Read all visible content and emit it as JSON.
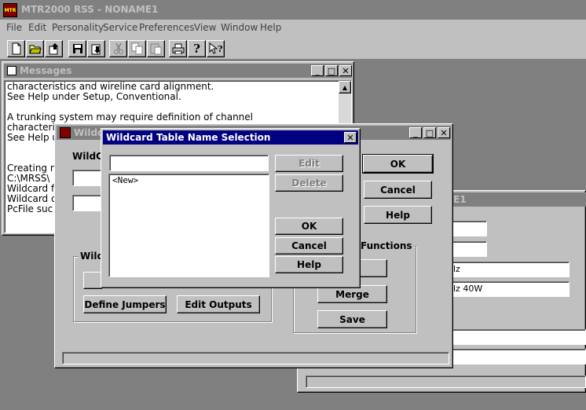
{
  "app": {
    "title": "MTR2000 RSS - NONAME1",
    "logo_text": "MTR"
  },
  "menu": [
    "File",
    "Edit",
    "Personality",
    "Service",
    "Preferences",
    "View",
    "Window",
    "Help"
  ],
  "toolbar_icons": [
    "new-file-icon",
    "open-folder-icon",
    "upload-icon",
    "save-disk-icon",
    "download-icon",
    "cut-icon",
    "copy-icon",
    "paste-icon",
    "print-icon",
    "help-question-icon",
    "context-help-icon"
  ],
  "messages": {
    "title": "Messages",
    "lines": [
      "characteristics and wireline card alignment.",
      "See Help under Setup, Conventional.",
      "",
      "A trunking system may require definition of channel",
      "characteristics",
      "See Help u",
      "",
      "",
      "Creating n",
      "C:\\MRSS\\",
      "Wildcard fi",
      "Wildcard d",
      "PcFile suc"
    ]
  },
  "wildcard_window": {
    "title": "Wildc",
    "label": "WildC",
    "ok": "OK",
    "cancel": "Cancel",
    "help": "Help",
    "group_label": "Wild",
    "define_jumpers": "Define Jumpers",
    "edit_outputs": "Edit Outputs",
    "functions_label": "Functions",
    "merge": "Merge",
    "save": "Save"
  },
  "background_window": {
    "title_fragment": "E1",
    "field_a": "lz",
    "field_b": "lz  40W"
  },
  "dialog": {
    "title": "Wildcard Table Name Selection",
    "name_value": "",
    "list_items": [
      "<New>"
    ],
    "edit": "Edit",
    "delete": "Delete",
    "ok": "OK",
    "cancel": "Cancel",
    "help": "Help"
  },
  "colors": {
    "active_title": "#000080",
    "inactive_title": "#808080",
    "face": "#c0c0c0",
    "desktop": "#808080"
  }
}
